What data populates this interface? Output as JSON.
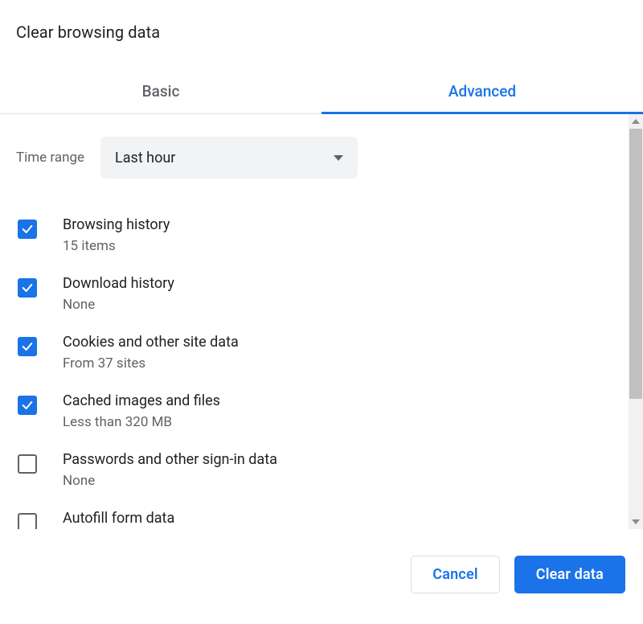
{
  "title": "Clear browsing data",
  "tabs": {
    "basic": "Basic",
    "advanced": "Advanced"
  },
  "timeRange": {
    "label": "Time range",
    "value": "Last hour"
  },
  "items": [
    {
      "title": "Browsing history",
      "sub": "15 items",
      "checked": true
    },
    {
      "title": "Download history",
      "sub": "None",
      "checked": true
    },
    {
      "title": "Cookies and other site data",
      "sub": "From 37 sites",
      "checked": true
    },
    {
      "title": "Cached images and files",
      "sub": "Less than 320 MB",
      "checked": true
    },
    {
      "title": "Passwords and other sign-in data",
      "sub": "None",
      "checked": false
    },
    {
      "title": "Autofill form data",
      "sub": "",
      "checked": false
    }
  ],
  "buttons": {
    "cancel": "Cancel",
    "clear": "Clear data"
  }
}
